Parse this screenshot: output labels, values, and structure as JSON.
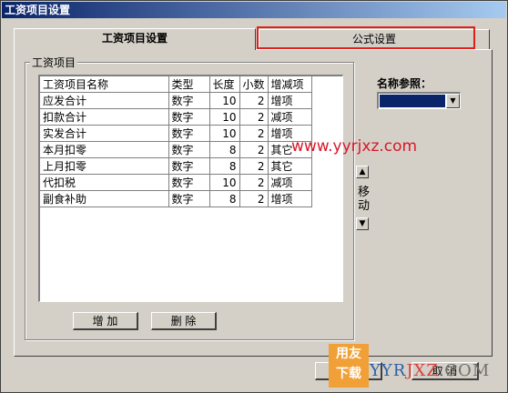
{
  "window": {
    "title": "工资项目设置"
  },
  "tabs": [
    {
      "label": "工资项目设置"
    },
    {
      "label": "公式设置"
    }
  ],
  "group": {
    "label": "工资项目"
  },
  "table": {
    "headers": [
      "工资项目名称",
      "类型",
      "长度",
      "小数",
      "增减项"
    ],
    "rows": [
      [
        "应发合计",
        "数字",
        "10",
        "2",
        "增项"
      ],
      [
        "扣款合计",
        "数字",
        "10",
        "2",
        "减项"
      ],
      [
        "实发合计",
        "数字",
        "10",
        "2",
        "增项"
      ],
      [
        "本月扣零",
        "数字",
        "8",
        "2",
        "其它"
      ],
      [
        "上月扣零",
        "数字",
        "8",
        "2",
        "其它"
      ],
      [
        "代扣税",
        "数字",
        "10",
        "2",
        "减项"
      ],
      [
        "副食补助",
        "数字",
        "8",
        "2",
        "增项"
      ]
    ]
  },
  "buttons": {
    "add": "增 加",
    "delete": "删 除",
    "cancel": "取 消"
  },
  "reference": {
    "label": "名称参照："
  },
  "move": {
    "label": "移动",
    "up_icon": "triangle-up-icon",
    "down_icon": "triangle-down-icon"
  },
  "watermark": {
    "url": "www.yyrjxz.com",
    "logo_top": "用友",
    "logo_bottom": "下载",
    "logo_text_a": "YYR",
    "logo_text_b": "JXZ",
    "logo_text_c": ".COM"
  },
  "colors": {
    "highlight": "#e0201c",
    "selection": "#0a246a",
    "window_bg": "#d4d0c8"
  }
}
